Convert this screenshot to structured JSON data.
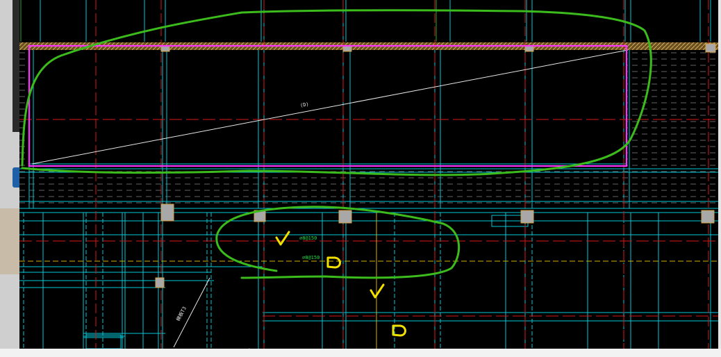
{
  "drawing": {
    "slab_label": "(D)",
    "rebar_labels": [
      "⌀8@150",
      "⌀8@150"
    ],
    "diagonal_label": "梯板T3"
  },
  "colors": {
    "background": "#000000",
    "grid_cyan": "#00c8d8",
    "axis_red": "#d81818",
    "axis_yellow": "#d8b000",
    "beam_white": "#e8e8e8",
    "selection_magenta": "#ff33ff",
    "hatch": "#c8a050",
    "column_fill": "#a8a8a8",
    "column_outline": "#d8a040",
    "markup_green": "#3cbc1c",
    "markup_yellow": "#f0e000"
  },
  "markup": {
    "check_marks": 2,
    "circle_marks": 2
  }
}
